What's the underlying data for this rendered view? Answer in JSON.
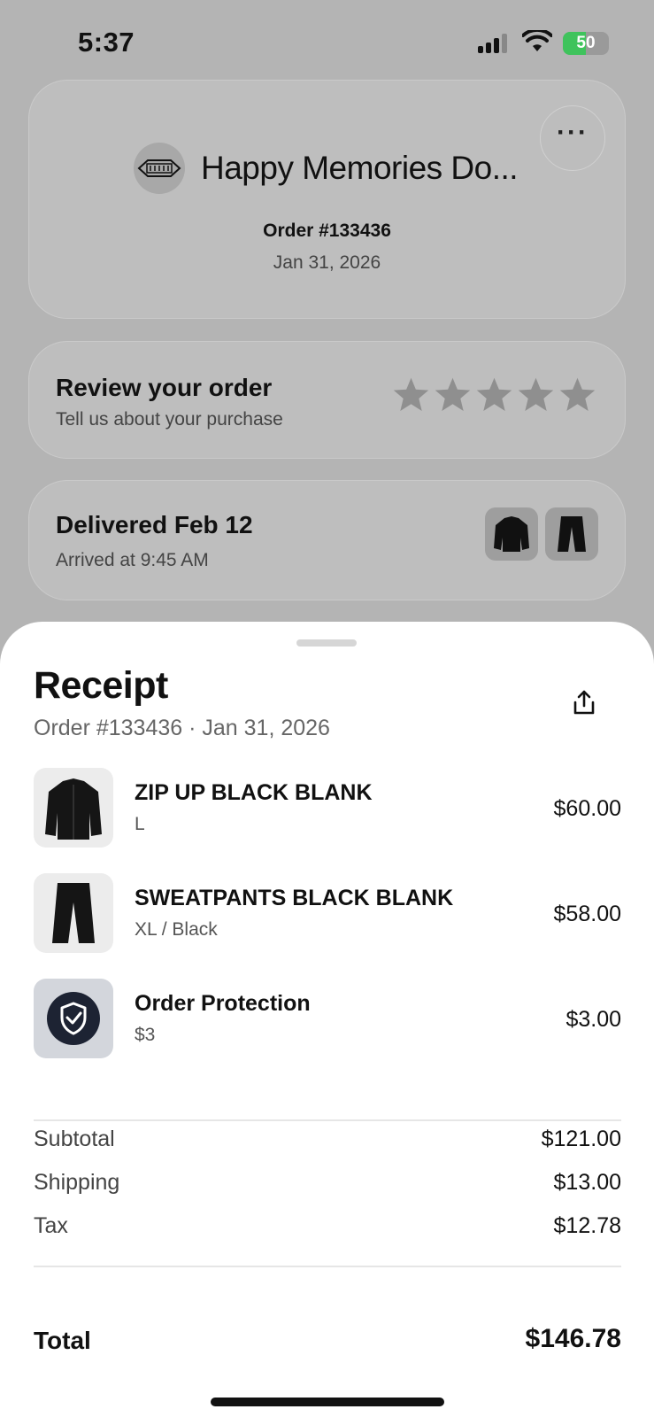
{
  "status_bar": {
    "time": "5:37",
    "battery": "50"
  },
  "store": {
    "name": "Happy Memories Do...",
    "order_number": "Order #133436",
    "order_date": "Jan 31, 2026"
  },
  "review": {
    "title": "Review your order",
    "subtitle": "Tell us about your purchase",
    "star_count": 5
  },
  "delivery": {
    "title": "Delivered Feb 12",
    "subtitle": "Arrived at 9:45 AM"
  },
  "receipt": {
    "title": "Receipt",
    "subtitle": "Order #133436 · Jan 31, 2026",
    "items": [
      {
        "name": "ZIP UP BLACK BLANK",
        "variant": "L",
        "price": "$60.00",
        "icon": "hoodie-icon"
      },
      {
        "name": "SWEATPANTS BLACK BLANK",
        "variant": "XL / Black",
        "price": "$58.00",
        "icon": "pants-icon"
      },
      {
        "name": "Order Protection",
        "variant": "$3",
        "price": "$3.00",
        "icon": "shield-check-icon"
      }
    ],
    "summary": [
      {
        "label": "Subtotal",
        "value": "$121.00"
      },
      {
        "label": "Shipping",
        "value": "$13.00"
      },
      {
        "label": "Tax",
        "value": "$12.78"
      }
    ],
    "total_label": "Total",
    "total_value": "$146.78"
  },
  "colors": {
    "dim_background": "#b4b4b4",
    "sheet": "#ffffff",
    "battery_green": "#3fc35c",
    "star_gray": "#8f8f8f"
  }
}
